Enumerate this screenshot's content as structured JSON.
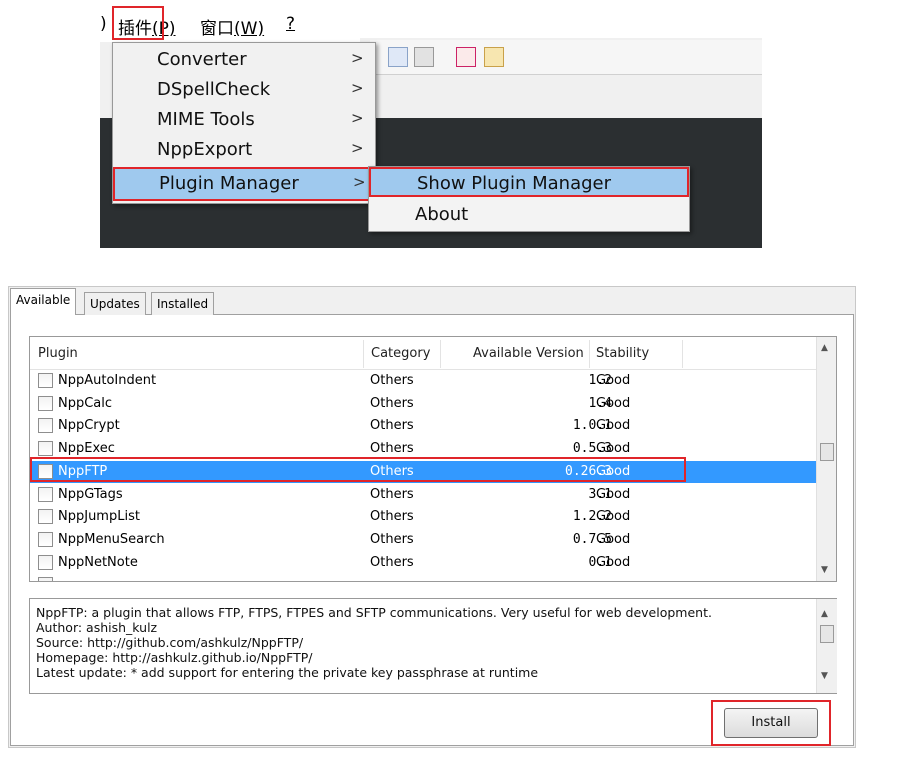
{
  "menubar": {
    "partial": ")",
    "plugins_label": "插件",
    "plugins_key": "(P)",
    "window_label": "窗口",
    "window_key": "(W)",
    "help_label": "?"
  },
  "plugins_menu": {
    "items": [
      {
        "label": "Converter",
        "arrow": ">"
      },
      {
        "label": "DSpellCheck",
        "arrow": ">"
      },
      {
        "label": "MIME Tools",
        "arrow": ">"
      },
      {
        "label": "NppExport",
        "arrow": ">"
      },
      {
        "label": "Plugin Manager",
        "arrow": ">"
      }
    ]
  },
  "plugin_manager_submenu": {
    "items": [
      {
        "label": "Show Plugin Manager"
      },
      {
        "label": "About"
      }
    ]
  },
  "dialog": {
    "tabs": [
      "Available",
      "Updates",
      "Installed"
    ],
    "columns": [
      "Plugin",
      "Category",
      "Available Version",
      "Stability"
    ],
    "rows": [
      {
        "name": "NppAutoIndent",
        "category": "Others",
        "version": "1.2",
        "stability": "Good",
        "selected": false
      },
      {
        "name": "NppCalc",
        "category": "Others",
        "version": "1.4",
        "stability": "Good",
        "selected": false
      },
      {
        "name": "NppCrypt",
        "category": "Others",
        "version": "1.0.1",
        "stability": "Good",
        "selected": false
      },
      {
        "name": "NppExec",
        "category": "Others",
        "version": "0.5.3",
        "stability": "Good",
        "selected": false
      },
      {
        "name": "NppFTP",
        "category": "Others",
        "version": "0.26.3",
        "stability": "Good",
        "selected": true
      },
      {
        "name": "NppGTags",
        "category": "Others",
        "version": "3.1",
        "stability": "Good",
        "selected": false
      },
      {
        "name": "NppJumpList",
        "category": "Others",
        "version": "1.2.2",
        "stability": "Good",
        "selected": false
      },
      {
        "name": "NppMenuSearch",
        "category": "Others",
        "version": "0.7.5",
        "stability": "Good",
        "selected": false
      },
      {
        "name": "NppNetNote",
        "category": "Others",
        "version": "0.1",
        "stability": "Good",
        "selected": false
      }
    ],
    "description": [
      "NppFTP: a plugin that allows FTP, FTPS, FTPES and SFTP communications. Very useful for web development.",
      "Author: ashish_kulz",
      "Source: http://github.com/ashkulz/NppFTP/",
      "Homepage: http://ashkulz.github.io/NppFTP/",
      "Latest update: * add support for entering the private key passphrase at runtime"
    ],
    "install_label": "Install"
  },
  "colors": {
    "highlight_outline": "#e0252a",
    "selected_row": "#3399ff",
    "menu_hover": "#9fc9ee",
    "editor_dark": "#2b2f31"
  }
}
